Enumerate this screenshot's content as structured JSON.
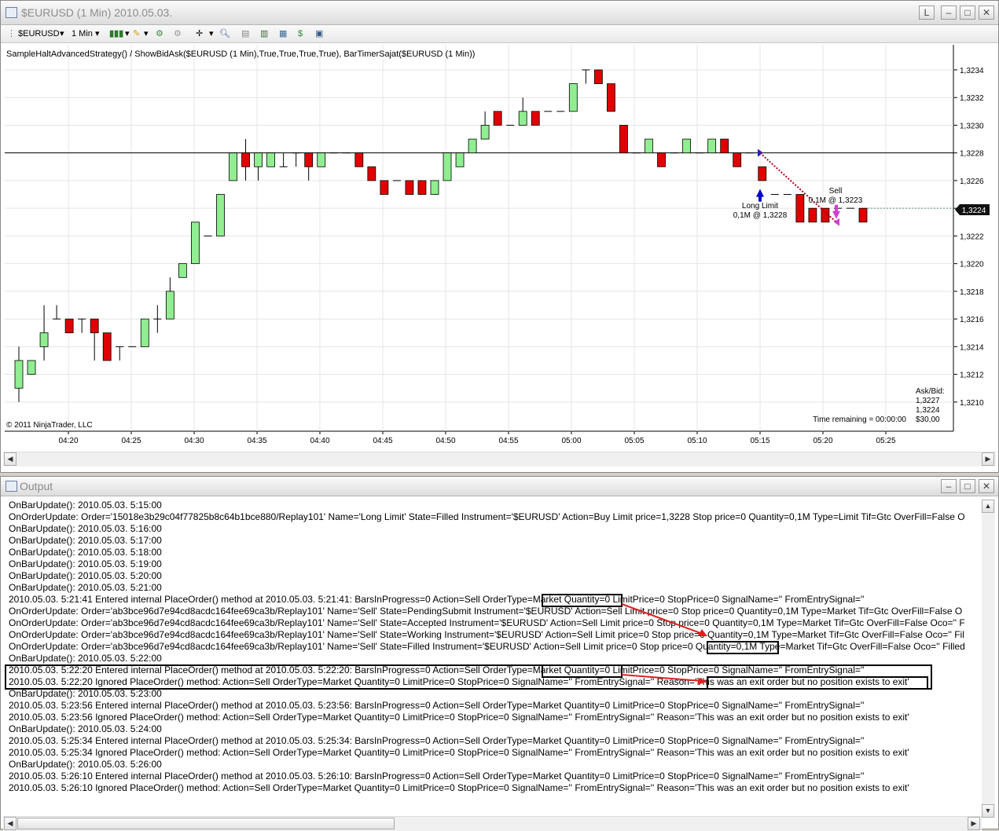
{
  "chart_window": {
    "title": "$EURUSD (1 Min)  2010.05.03.",
    "buttons": {
      "lock": "L"
    },
    "toolbar": {
      "instrument": "$EURUSD",
      "interval": "1 Min"
    },
    "indicator_line": "SampleHaltAdvancedStrategy() / ShowBidAsk($EURUSD (1 Min),True,True,True,True), BarTimerSajat($EURUSD (1 Min))",
    "copyright": "© 2011 NinjaTrader, LLC",
    "time_remaining": "Time remaining = 00:00:00",
    "ask_bid_label": "Ask/Bid:",
    "ask_value": "1,3227",
    "bid_value": "1,3224",
    "spread_value": "$30,00",
    "current_price": "1,3224",
    "order_long_title": "Long Limit",
    "order_long_detail": "0,1M @ 1,3228",
    "order_sell_title": "Sell",
    "order_sell_detail": "0,1M @ 1,3223"
  },
  "chart_data": {
    "type": "candlestick",
    "y_ticks": [
      "1,3210",
      "1,3212",
      "1,3214",
      "1,3216",
      "1,3218",
      "1,3220",
      "1,3222",
      "1,3224",
      "1,3226",
      "1,3228",
      "1,3230",
      "1,3232",
      "1,3234"
    ],
    "x_ticks": [
      "04:20",
      "04:25",
      "04:30",
      "04:35",
      "04:40",
      "04:45",
      "04:50",
      "04:55",
      "05:00",
      "05:05",
      "05:10",
      "05:15",
      "05:20",
      "05:25"
    ],
    "ylim": [
      1.32088,
      1.32357
    ],
    "horizontal_line": 1.3228,
    "candles": [
      {
        "o": 1.3211,
        "h": 1.3214,
        "l": 1.321,
        "c": 1.3213
      },
      {
        "o": 1.3212,
        "h": 1.3213,
        "l": 1.3212,
        "c": 1.3213
      },
      {
        "o": 1.3214,
        "h": 1.3217,
        "l": 1.3213,
        "c": 1.3215
      },
      {
        "o": 1.3216,
        "h": 1.3217,
        "l": 1.3216,
        "c": 1.3216
      },
      {
        "o": 1.3216,
        "h": 1.3216,
        "l": 1.3215,
        "c": 1.3215
      },
      {
        "o": 1.3216,
        "h": 1.3216,
        "l": 1.3215,
        "c": 1.3216
      },
      {
        "o": 1.3216,
        "h": 1.3216,
        "l": 1.3213,
        "c": 1.3215
      },
      {
        "o": 1.3215,
        "h": 1.3215,
        "l": 1.3213,
        "c": 1.3213
      },
      {
        "o": 1.3214,
        "h": 1.3214,
        "l": 1.3213,
        "c": 1.3214
      },
      {
        "o": 1.3214,
        "h": 1.3214,
        "l": 1.3214,
        "c": 1.3214
      },
      {
        "o": 1.3214,
        "h": 1.3216,
        "l": 1.3214,
        "c": 1.3216
      },
      {
        "o": 1.3216,
        "h": 1.3217,
        "l": 1.3215,
        "c": 1.3216
      },
      {
        "o": 1.3216,
        "h": 1.3219,
        "l": 1.3216,
        "c": 1.3218
      },
      {
        "o": 1.3219,
        "h": 1.322,
        "l": 1.3219,
        "c": 1.322
      },
      {
        "o": 1.322,
        "h": 1.3223,
        "l": 1.322,
        "c": 1.3223
      },
      {
        "o": 1.3222,
        "h": 1.3222,
        "l": 1.3222,
        "c": 1.3222
      },
      {
        "o": 1.3222,
        "h": 1.3225,
        "l": 1.3222,
        "c": 1.3225
      },
      {
        "o": 1.3226,
        "h": 1.3228,
        "l": 1.3226,
        "c": 1.3228
      },
      {
        "o": 1.3228,
        "h": 1.3229,
        "l": 1.3226,
        "c": 1.3227
      },
      {
        "o": 1.3227,
        "h": 1.3228,
        "l": 1.3226,
        "c": 1.3228
      },
      {
        "o": 1.3227,
        "h": 1.3228,
        "l": 1.3227,
        "c": 1.3228
      },
      {
        "o": 1.3227,
        "h": 1.3228,
        "l": 1.3227,
        "c": 1.3227
      },
      {
        "o": 1.3228,
        "h": 1.3228,
        "l": 1.3227,
        "c": 1.3228
      },
      {
        "o": 1.3228,
        "h": 1.3228,
        "l": 1.3226,
        "c": 1.3227
      },
      {
        "o": 1.3227,
        "h": 1.3228,
        "l": 1.3227,
        "c": 1.3228
      },
      {
        "o": 1.3228,
        "h": 1.3228,
        "l": 1.3228,
        "c": 1.3228
      },
      {
        "o": 1.3228,
        "h": 1.3228,
        "l": 1.3228,
        "c": 1.3228
      },
      {
        "o": 1.3228,
        "h": 1.3228,
        "l": 1.3227,
        "c": 1.3227
      },
      {
        "o": 1.3227,
        "h": 1.3227,
        "l": 1.3226,
        "c": 1.3226
      },
      {
        "o": 1.3226,
        "h": 1.3226,
        "l": 1.3225,
        "c": 1.3225
      },
      {
        "o": 1.3226,
        "h": 1.3226,
        "l": 1.3226,
        "c": 1.3226
      },
      {
        "o": 1.3226,
        "h": 1.3226,
        "l": 1.3225,
        "c": 1.3225
      },
      {
        "o": 1.3226,
        "h": 1.3226,
        "l": 1.3225,
        "c": 1.3225
      },
      {
        "o": 1.3225,
        "h": 1.3226,
        "l": 1.3225,
        "c": 1.3226
      },
      {
        "o": 1.3226,
        "h": 1.3228,
        "l": 1.3226,
        "c": 1.3228
      },
      {
        "o": 1.3227,
        "h": 1.3228,
        "l": 1.3227,
        "c": 1.3228
      },
      {
        "o": 1.3228,
        "h": 1.3229,
        "l": 1.3228,
        "c": 1.3229
      },
      {
        "o": 1.3229,
        "h": 1.3231,
        "l": 1.3229,
        "c": 1.323
      },
      {
        "o": 1.3231,
        "h": 1.3231,
        "l": 1.323,
        "c": 1.323
      },
      {
        "o": 1.323,
        "h": 1.323,
        "l": 1.323,
        "c": 1.323
      },
      {
        "o": 1.323,
        "h": 1.3232,
        "l": 1.323,
        "c": 1.3231
      },
      {
        "o": 1.3231,
        "h": 1.3231,
        "l": 1.323,
        "c": 1.323
      },
      {
        "o": 1.3231,
        "h": 1.3231,
        "l": 1.3231,
        "c": 1.3231
      },
      {
        "o": 1.3231,
        "h": 1.3231,
        "l": 1.3231,
        "c": 1.3231
      },
      {
        "o": 1.3231,
        "h": 1.3233,
        "l": 1.3231,
        "c": 1.3233
      },
      {
        "o": 1.3234,
        "h": 1.3234,
        "l": 1.3233,
        "c": 1.3234
      },
      {
        "o": 1.3234,
        "h": 1.3234,
        "l": 1.3233,
        "c": 1.3233
      },
      {
        "o": 1.3233,
        "h": 1.3233,
        "l": 1.3231,
        "c": 1.3231
      },
      {
        "o": 1.323,
        "h": 1.323,
        "l": 1.3228,
        "c": 1.3228
      },
      {
        "o": 1.3228,
        "h": 1.3228,
        "l": 1.3228,
        "c": 1.3228
      },
      {
        "o": 1.3228,
        "h": 1.3229,
        "l": 1.3228,
        "c": 1.3229
      },
      {
        "o": 1.3228,
        "h": 1.3228,
        "l": 1.3227,
        "c": 1.3227
      },
      {
        "o": 1.3228,
        "h": 1.3228,
        "l": 1.3228,
        "c": 1.3228
      },
      {
        "o": 1.3228,
        "h": 1.3229,
        "l": 1.3228,
        "c": 1.3229
      },
      {
        "o": 1.3228,
        "h": 1.3228,
        "l": 1.3228,
        "c": 1.3228
      },
      {
        "o": 1.3228,
        "h": 1.3229,
        "l": 1.3228,
        "c": 1.3229
      },
      {
        "o": 1.3229,
        "h": 1.3229,
        "l": 1.3228,
        "c": 1.3228
      },
      {
        "o": 1.3228,
        "h": 1.3228,
        "l": 1.3227,
        "c": 1.3227
      },
      {
        "o": 1.3228,
        "h": 1.3228,
        "l": 1.3228,
        "c": 1.3228
      },
      {
        "o": 1.3227,
        "h": 1.3227,
        "l": 1.3226,
        "c": 1.3226
      },
      {
        "o": 1.3225,
        "h": 1.3225,
        "l": 1.3225,
        "c": 1.3225
      },
      {
        "o": 1.3225,
        "h": 1.3225,
        "l": 1.3225,
        "c": 1.3225
      },
      {
        "o": 1.3225,
        "h": 1.3225,
        "l": 1.3223,
        "c": 1.3223
      },
      {
        "o": 1.3224,
        "h": 1.3224,
        "l": 1.3223,
        "c": 1.3223
      },
      {
        "o": 1.3224,
        "h": 1.3224,
        "l": 1.3223,
        "c": 1.3223
      },
      {
        "o": 1.3224,
        "h": 1.3224,
        "l": 1.3224,
        "c": 1.3224
      },
      {
        "o": 1.3224,
        "h": 1.3224,
        "l": 1.3224,
        "c": 1.3224
      },
      {
        "o": 1.3224,
        "h": 1.3224,
        "l": 1.3223,
        "c": 1.3223
      }
    ]
  },
  "output_window": {
    "title": "Output",
    "lines": [
      "OnBarUpdate(): 2010.05.03. 5:15:00",
      "OnOrderUpdate: Order='15018e3b29c04f77825b8c64b1bce880/Replay101' Name='Long Limit' State=Filled Instrument='$EURUSD' Action=Buy Limit price=1,3228 Stop price=0 Quantity=0,1M Type=Limit Tif=Gtc OverFill=False O",
      "OnBarUpdate(): 2010.05.03. 5:16:00",
      "OnBarUpdate(): 2010.05.03. 5:17:00",
      "OnBarUpdate(): 2010.05.03. 5:18:00",
      "OnBarUpdate(): 2010.05.03. 5:19:00",
      "OnBarUpdate(): 2010.05.03. 5:20:00",
      "OnBarUpdate(): 2010.05.03. 5:21:00",
      "2010.05.03. 5:21:41 Entered internal PlaceOrder() method at 2010.05.03. 5:21:41: BarsInProgress=0 Action=Sell OrderType=Market Quantity=0 LimitPrice=0 StopPrice=0 SignalName='' FromEntrySignal=''",
      "OnOrderUpdate: Order='ab3bce96d7e94cd8acdc164fee69ca3b/Replay101' Name='Sell' State=PendingSubmit Instrument='$EURUSD' Action=Sell Limit price=0 Stop price=0 Quantity=0,1M Type=Market Tif=Gtc OverFill=False O",
      "OnOrderUpdate: Order='ab3bce96d7e94cd8acdc164fee69ca3b/Replay101' Name='Sell' State=Accepted Instrument='$EURUSD' Action=Sell Limit price=0 Stop price=0 Quantity=0,1M Type=Market Tif=Gtc OverFill=False Oco='' F",
      "OnOrderUpdate: Order='ab3bce96d7e94cd8acdc164fee69ca3b/Replay101' Name='Sell' State=Working Instrument='$EURUSD' Action=Sell Limit price=0 Stop price=0 Quantity=0,1M Type=Market Tif=Gtc OverFill=False Oco='' Fil",
      "OnOrderUpdate: Order='ab3bce96d7e94cd8acdc164fee69ca3b/Replay101' Name='Sell' State=Filled Instrument='$EURUSD' Action=Sell Limit price=0 Stop price=0 Quantity=0,1M Type=Market Tif=Gtc OverFill=False Oco='' Filled",
      "OnBarUpdate(): 2010.05.03. 5:22:00",
      "2010.05.03. 5:22:20 Entered internal PlaceOrder() method at 2010.05.03. 5:22:20: BarsInProgress=0 Action=Sell OrderType=Market Quantity=0 LimitPrice=0 StopPrice=0 SignalName='' FromEntrySignal=''",
      "2010.05.03. 5:22:20 Ignored PlaceOrder() method: Action=Sell OrderType=Market Quantity=0 LimitPrice=0 StopPrice=0 SignalName='' FromEntrySignal='' Reason='This was an exit order but no position exists to exit'",
      "OnBarUpdate(): 2010.05.03. 5:23:00",
      "2010.05.03. 5:23:56 Entered internal PlaceOrder() method at 2010.05.03. 5:23:56: BarsInProgress=0 Action=Sell OrderType=Market Quantity=0 LimitPrice=0 StopPrice=0 SignalName='' FromEntrySignal=''",
      "2010.05.03. 5:23:56 Ignored PlaceOrder() method: Action=Sell OrderType=Market Quantity=0 LimitPrice=0 StopPrice=0 SignalName='' FromEntrySignal='' Reason='This was an exit order but no position exists to exit'",
      "OnBarUpdate(): 2010.05.03. 5:24:00",
      "2010.05.03. 5:25:34 Entered internal PlaceOrder() method at 2010.05.03. 5:25:34: BarsInProgress=0 Action=Sell OrderType=Market Quantity=0 LimitPrice=0 StopPrice=0 SignalName='' FromEntrySignal=''",
      "2010.05.03. 5:25:34 Ignored PlaceOrder() method: Action=Sell OrderType=Market Quantity=0 LimitPrice=0 StopPrice=0 SignalName='' FromEntrySignal='' Reason='This was an exit order but no position exists to exit'",
      "OnBarUpdate(): 2010.05.03. 5:26:00",
      "2010.05.03. 5:26:10 Entered internal PlaceOrder() method at 2010.05.03. 5:26:10: BarsInProgress=0 Action=Sell OrderType=Market Quantity=0 LimitPrice=0 StopPrice=0 SignalName='' FromEntrySignal=''",
      "2010.05.03. 5:26:10 Ignored PlaceOrder() method: Action=Sell OrderType=Market Quantity=0 LimitPrice=0 StopPrice=0 SignalName='' FromEntrySignal='' Reason='This was an exit order but no position exists to exit'"
    ]
  },
  "colors": {
    "up_candle": "#90ee90",
    "down_candle": "#e00000",
    "annotation_red": "#e02020",
    "sell_marker": "#d040d0",
    "buy_marker": "#0000cc"
  }
}
